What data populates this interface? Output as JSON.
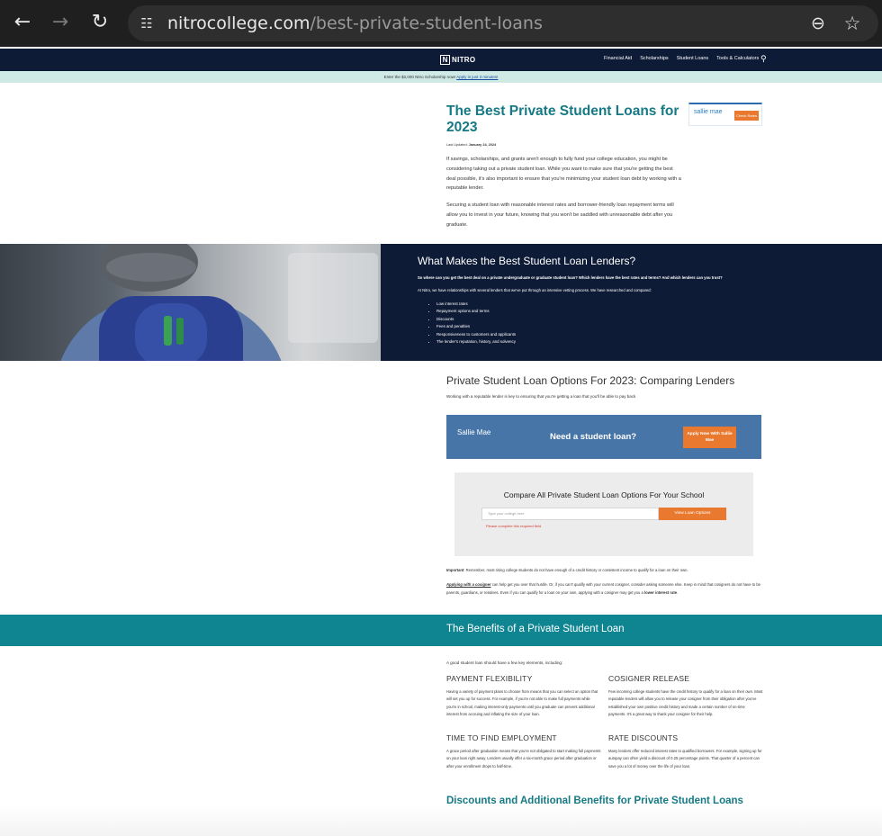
{
  "browser": {
    "url_domain": "nitrocollege.com",
    "url_path": "/best-private-student-loans",
    "back_icon": "arrow-left-icon",
    "forward_icon": "arrow-right-icon",
    "reload_icon": "reload-icon",
    "site_info_icon": "tune-icon",
    "zoom_icon": "zoom-out-icon",
    "bookmark_icon": "star-icon"
  },
  "site": {
    "logo_text": "NITRO",
    "logo_mark": "N",
    "nav": [
      "Financial Aid",
      "Scholarships",
      "Student Loans",
      "Tools & Calculators"
    ],
    "promo_text": "Enter the $2,000 Nitro Scholarship now!",
    "promo_link": "Apply in just 3 minutes!"
  },
  "article": {
    "title": "The Best Private Student Loans for 2023",
    "updated_label": "Last Updated:",
    "updated_date": "January 24, 2024",
    "intro_1": "If savings, scholarships, and grants aren't enough to fully fund your college education, you might be considering taking out a private student loan. While you want to make sure that you're getting the best deal possible, it's also important to ensure that you're minimizing your student loan debt by working with a reputable lender.",
    "intro_2": "Securing a student loan with reasonable interest rates and borrower-friendly loan repayment terms will allow you to invest in your future, knowing that you won't be saddled with unreasonable debt after you graduate."
  },
  "top_ad": {
    "brand": "sallie mae",
    "cta": "Check Rates"
  },
  "band": {
    "title": "What Makes the Best Student Loan Lenders?",
    "question": "So where can you get the best deal on a private undergraduate or graduate student loan? Which lenders have the best rates and terms? And which lenders can you trust?",
    "text": "At Nitro, we have relationships with several lenders that we've put through an intensive vetting process. We have researched and compared:",
    "items": [
      "Low interest rates",
      "Repayment options and terms",
      "Discounts",
      "Fees and penalties",
      "Responsiveness to customers and applicants",
      "The lender's reputation, history, and solvency"
    ]
  },
  "compare_section": {
    "title": "Private Student Loan Options For 2023: Comparing Lenders",
    "subtitle": "Working with a reputable lender is key to ensuring that you're getting a loan that you'll be able to pay back",
    "banner_brand": "Sallie Mae",
    "banner_text": "Need a student loan?",
    "banner_cta": "Apply Now With Sallie Mae",
    "box_title": "Compare All Private Student Loan Options For Your School",
    "input_placeholder": "Type your college here",
    "button": "View Loan Options",
    "error": "Please complete this required field.",
    "important_label": "Important",
    "important_text": ": Remember, most rising college students do not have enough of a credit history or consistent income to qualify for a loan on their own.",
    "cosigner_label": "Applying with a cosigner",
    "cosigner_text": " can help get you over that hurdle. Or, if you can't qualify with your current cosigner, consider asking someone else. Keep in mind that cosigners do not have to be parents, guardians, or relatives. Even if you can qualify for a loan on your own, applying with a cosigner may get you a ",
    "cosigner_bold": "lower interest rate",
    "cosigner_end": "."
  },
  "benefits": {
    "title": "The Benefits of a Private Student Loan",
    "lead": "A good student loan should have a few key elements, including:",
    "items": [
      {
        "heading": "PAYMENT FLEXIBILITY",
        "text": "Having a variety of payment plans to choose from means that you can select an option that will set you up for success. For example, if you're not able to make full payments while you're in school, making interest-only payments until you graduate can prevent additional interest from accruing and inflating the size of your loan."
      },
      {
        "heading": "COSIGNER RELEASE",
        "text": "Few incoming college students have the credit history to qualify for a loan on their own. Most reputable lenders will allow you to release your cosigner from their obligation after you've established your own positive credit history and made a certain number of on-time payments. It's a great way to thank your cosigner for their help."
      },
      {
        "heading": "TIME TO FIND EMPLOYMENT",
        "text": "A grace period after graduation means that you're not obligated to start making full payments on your loan right away. Lenders usually offer a six-month grace period after graduation or after your enrollment drops to half-time."
      },
      {
        "heading": "RATE DISCOUNTS",
        "text": "Many lenders offer reduced interest rates to qualified borrowers. For example, signing up for autopay can often yield a discount of 0.25 percentage points. That quarter of a percent can save you a lot of money over the life of your loan."
      }
    ]
  },
  "discounts": {
    "title": "Discounts and Additional Benefits for Private Student Loans"
  }
}
